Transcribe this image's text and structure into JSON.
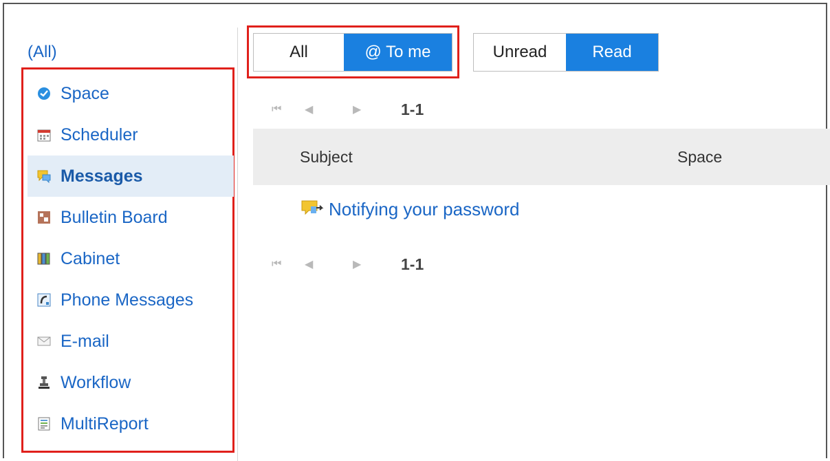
{
  "sidebar": {
    "all_label": "(All)",
    "items": [
      {
        "label": "Space",
        "icon": "space-icon"
      },
      {
        "label": "Scheduler",
        "icon": "scheduler-icon"
      },
      {
        "label": "Messages",
        "icon": "messages-icon",
        "active": true
      },
      {
        "label": "Bulletin Board",
        "icon": "bulletin-board-icon"
      },
      {
        "label": "Cabinet",
        "icon": "cabinet-icon"
      },
      {
        "label": "Phone Messages",
        "icon": "phone-messages-icon"
      },
      {
        "label": "E-mail",
        "icon": "email-icon"
      },
      {
        "label": "Workflow",
        "icon": "workflow-icon"
      },
      {
        "label": "MultiReport",
        "icon": "multireport-icon"
      }
    ]
  },
  "filters": {
    "scope": {
      "options": [
        "All",
        "@ To me"
      ],
      "selected": "@ To me"
    },
    "read_state": {
      "options": [
        "Unread",
        "Read"
      ],
      "selected": "Read"
    }
  },
  "pager": {
    "first": "⏮",
    "prev": "◀",
    "next": "▶",
    "range": "1-1"
  },
  "table": {
    "headers": [
      "Subject",
      "Space"
    ],
    "rows": [
      {
        "subject": "Notifying your password",
        "icon": "message-icon"
      }
    ]
  },
  "colors": {
    "accent": "#1a80e0",
    "link": "#1a66c5",
    "highlight": "#e0201b"
  }
}
